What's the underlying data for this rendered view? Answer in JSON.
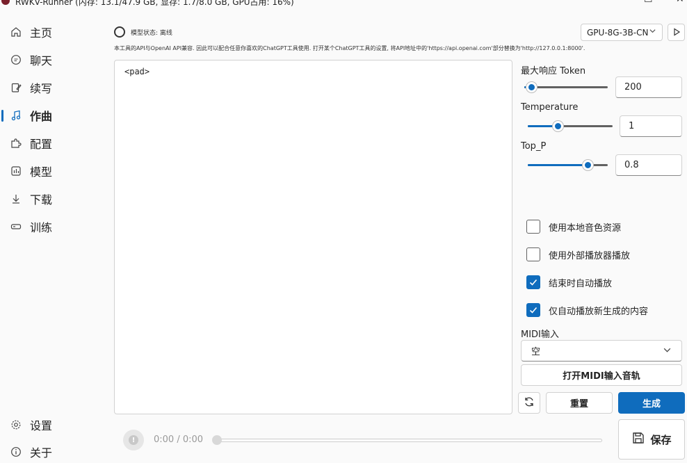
{
  "window": {
    "title": "RWKV-Runner (内存: 13.1/47.9 GB, 显存: 1.7/8.0 GB, GPU占用: 16%)",
    "minimize": "—",
    "maximize": "☐",
    "close": "✕"
  },
  "sidebar": {
    "items": [
      {
        "label": "主页",
        "icon": "home-icon"
      },
      {
        "label": "聊天",
        "icon": "chat-icon"
      },
      {
        "label": "续写",
        "icon": "edit-icon"
      },
      {
        "label": "作曲",
        "icon": "music-note-icon",
        "active": true
      },
      {
        "label": "配置",
        "icon": "puzzle-icon"
      },
      {
        "label": "模型",
        "icon": "model-icon"
      },
      {
        "label": "下载",
        "icon": "download-icon"
      },
      {
        "label": "训练",
        "icon": "train-icon"
      }
    ],
    "bottom": [
      {
        "label": "设置",
        "icon": "settings-icon"
      },
      {
        "label": "关于",
        "icon": "info-icon"
      }
    ]
  },
  "header": {
    "status_label": "模型状态: 离线",
    "model_selected": "GPU-8G-3B-CN",
    "notice": "本工具的API与OpenAI API兼容. 因此可以配合任意你喜欢的ChatGPT工具使用. 打开某个ChatGPT工具的设置, 将API地址中的'https://api.openai.com'部分替换为'http://127.0.0.1:8000'."
  },
  "editor": {
    "content": "<pad>"
  },
  "params": {
    "max_tokens": {
      "label": "最大响应 Token",
      "value": "200",
      "fraction": 0.02
    },
    "temperature": {
      "label": "Temperature",
      "value": "1",
      "fraction": 0.33
    },
    "top_p": {
      "label": "Top_P",
      "value": "0.8",
      "fraction": 0.8
    }
  },
  "options": [
    {
      "label": "使用本地音色资源",
      "checked": false
    },
    {
      "label": "使用外部播放器播放",
      "checked": false
    },
    {
      "label": "结束时自动播放",
      "checked": true
    },
    {
      "label": "仅自动播放新生成的内容",
      "checked": true
    }
  ],
  "midi": {
    "label": "MIDI输入",
    "selected": "空",
    "open_track_button": "打开MIDI输入音轨"
  },
  "actions": {
    "reset": "重置",
    "generate": "生成",
    "save": "保存"
  },
  "player": {
    "time": "0:00 / 0:00"
  },
  "colors": {
    "accent": "#0f6cbd"
  }
}
